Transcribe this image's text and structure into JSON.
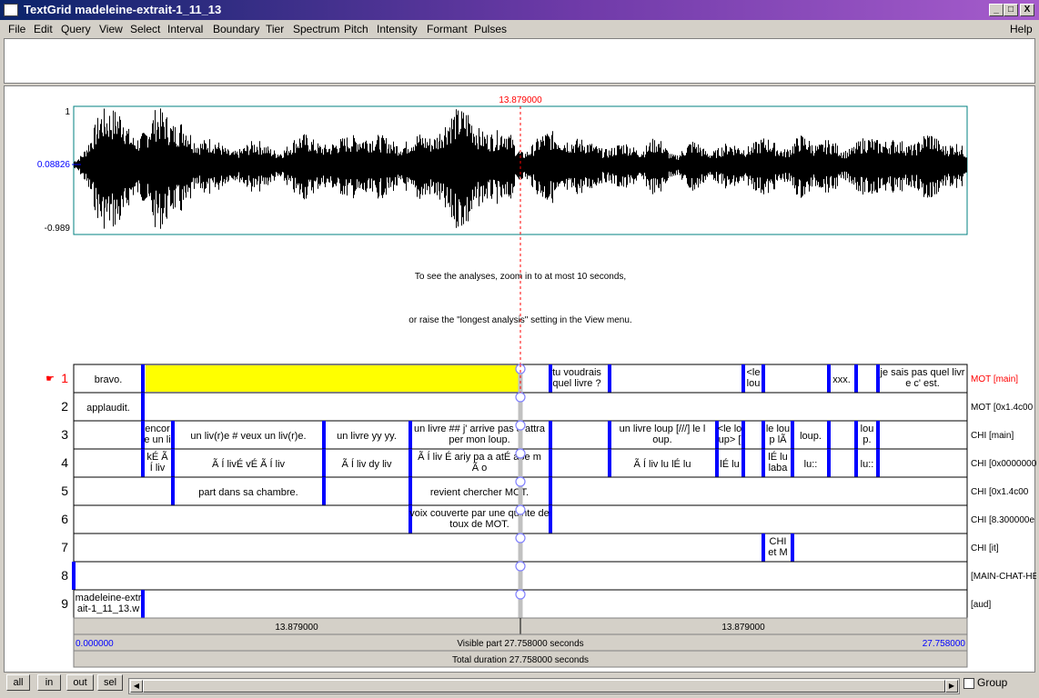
{
  "window": {
    "title": "TextGrid madeleine-extrait-1_11_13",
    "controls": {
      "minimize": "_",
      "maximize": "□",
      "close": "X"
    }
  },
  "menu": [
    "File",
    "Edit",
    "Query",
    "View",
    "Select",
    "Interval",
    "Boundary",
    "Tier",
    "Spectrum",
    "Pitch",
    "Intensity",
    "Formant",
    "Pulses"
  ],
  "help_label": "Help",
  "cursor": {
    "time_label": "13.879000"
  },
  "waveform": {
    "ymax": "1",
    "ycursor": "0.08826",
    "ymin": "-0.989"
  },
  "analysis_message": {
    "line1": "To see the analyses, zoom in to at most 10 seconds,",
    "line2": "or raise the \"longest analysis\" setting in the View menu."
  },
  "tiers": [
    {
      "num": "1",
      "name": "MOT [main]",
      "selected": true,
      "intervals": [
        {
          "l": [
            "bravo."
          ]
        },
        {
          "l": [
            "tu voudrais",
            "quel livre ?"
          ]
        },
        {
          "l": [
            "<le",
            "lou"
          ]
        },
        {
          "l": [
            "xxx."
          ]
        },
        {
          "l": [
            "je sais pas quel livr",
            "e c' est."
          ]
        }
      ]
    },
    {
      "num": "2",
      "name": "MOT [0x1.4c00",
      "intervals": [
        {
          "l": [
            "applaudit."
          ]
        }
      ]
    },
    {
      "num": "3",
      "name": "CHI [main]",
      "intervals": [
        {
          "l": [
            "encor",
            "e un li"
          ]
        },
        {
          "l": [
            "un liv(r)e # veux un liv(r)e."
          ]
        },
        {
          "l": [
            "un livre yy yy."
          ]
        },
        {
          "l": [
            "un livre ## j' arrive pas à attra",
            "per mon loup."
          ]
        },
        {
          "l": [
            "un livre loup [///] le l",
            "oup."
          ]
        },
        {
          "l": [
            "<le lo",
            "up> ["
          ]
        },
        {
          "l": [
            "le lou",
            "p lÃ"
          ]
        },
        {
          "l": [
            "loup."
          ]
        },
        {
          "l": [
            "lou",
            "p."
          ]
        }
      ]
    },
    {
      "num": "4",
      "name": "CHI [0x0000000",
      "intervals": [
        {
          "l": [
            "kÉ   Ã",
            "Í   liv"
          ]
        },
        {
          "l": [
            "Ã Í  livÉ  vÉ  Ã Í  liv"
          ]
        },
        {
          "l": [
            "Ã Í  liv dy liv"
          ]
        },
        {
          "l": [
            "Ã Í  liv É  ariy pa a atÉ ape m",
            "Ã  o"
          ]
        },
        {
          "l": [
            "Ã Í  liv lu lÉ  lu"
          ]
        },
        {
          "l": [
            "lÉ  lu"
          ]
        },
        {
          "l": [
            "lÉ  lu",
            "laba"
          ]
        },
        {
          "l": [
            "lu::"
          ]
        },
        {
          "l": [
            "lu::"
          ]
        }
      ]
    },
    {
      "num": "5",
      "name": "CHI [0x1.4c00",
      "intervals": [
        {
          "l": [
            "part dans sa chambre."
          ]
        },
        {
          "l": [
            "revient chercher MOT."
          ]
        }
      ]
    },
    {
      "num": "6",
      "name": "CHI [8.300000e",
      "intervals": [
        {
          "l": [
            "voix couverte par une quinte de",
            "toux de MOT."
          ]
        }
      ]
    },
    {
      "num": "7",
      "name": "CHI [it]",
      "intervals": [
        {
          "l": [
            "CHI",
            "et M"
          ]
        }
      ]
    },
    {
      "num": "8",
      "name": "[MAIN-CHAT-HE",
      "intervals": []
    },
    {
      "num": "9",
      "name": "[aud]",
      "intervals": [
        {
          "l": [
            "madeleine-extr",
            "ait-1_11_13.w"
          ]
        }
      ]
    }
  ],
  "time_axis": {
    "left_half": "13.879000",
    "right_half": "13.879000",
    "start": "0.000000",
    "end": "27.758000",
    "visible": "Visible part 27.758000 seconds",
    "total": "Total duration 27.758000 seconds"
  },
  "bottom_buttons": [
    "all",
    "in",
    "out",
    "sel"
  ],
  "group_label": "Group",
  "colors": {
    "selection": "#ffff00",
    "boundary": "#0000ff",
    "cursor": "#ff0000",
    "frame": "#008080"
  }
}
